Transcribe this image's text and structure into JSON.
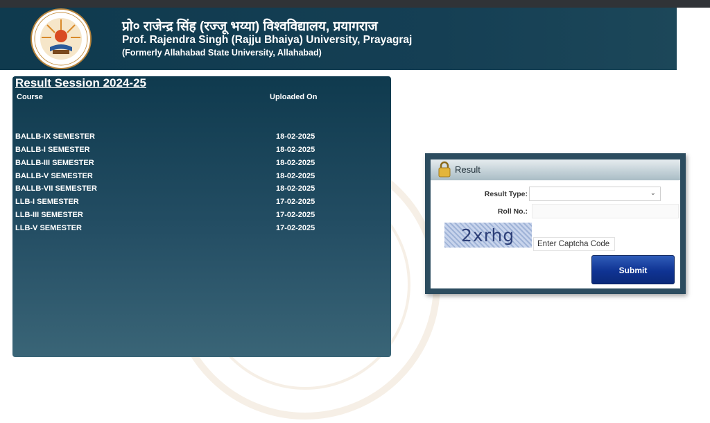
{
  "header": {
    "title_hindi": "प्रो० राजेन्द्र सिंह (रज्जू भय्या) विश्वविद्यालय, प्रयागराज",
    "title_english": "Prof. Rajendra Singh (Rajju Bhaiya) University, Prayagraj",
    "subtitle": "(Formerly Allahabad State University, Allahabad)"
  },
  "results": {
    "session_title": "Result Session 2024-25",
    "col_course": "Course",
    "col_uploaded": "Uploaded On",
    "rows": [
      {
        "course": "BALLB-IX SEMESTER",
        "date": "18-02-2025"
      },
      {
        "course": "BALLB-I SEMESTER",
        "date": "18-02-2025"
      },
      {
        "course": "BALLB-III SEMESTER",
        "date": "18-02-2025"
      },
      {
        "course": "BALLB-V SEMESTER",
        "date": "18-02-2025"
      },
      {
        "course": "BALLB-VII SEMESTER",
        "date": "18-02-2025"
      },
      {
        "course": "LLB-I SEMESTER",
        "date": "17-02-2025"
      },
      {
        "course": "LLB-III SEMESTER",
        "date": "17-02-2025"
      },
      {
        "course": "LLB-V SEMESTER",
        "date": "17-02-2025"
      }
    ]
  },
  "form": {
    "title": "Result",
    "result_type_label": "Result Type:",
    "result_type_value": "",
    "roll_label": "Roll No.:",
    "roll_value": "",
    "captcha_text": "2xrhg",
    "captcha_placeholder": "Enter Captcha Code",
    "submit_label": "Submit"
  },
  "icons": {
    "lock": "lock-icon",
    "dropdown": "chevron-down-icon",
    "logo": "university-emblem"
  },
  "colors": {
    "header_bg": "#0f3a4e",
    "panel_bg": "#244e64",
    "submit_bg": "#0f3393"
  }
}
